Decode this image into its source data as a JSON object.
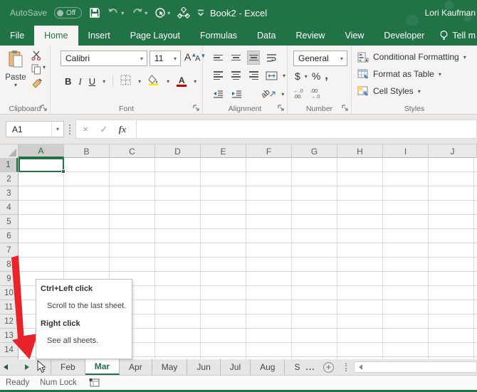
{
  "titlebar": {
    "autosave_label": "AutoSave",
    "autosave_state": "Off",
    "title": "Book2  -  Excel",
    "user": "Lori Kaufman"
  },
  "ribbon_tabs": {
    "items": [
      {
        "label": "File",
        "active": false
      },
      {
        "label": "Home",
        "active": true
      },
      {
        "label": "Insert",
        "active": false
      },
      {
        "label": "Page Layout",
        "active": false
      },
      {
        "label": "Formulas",
        "active": false
      },
      {
        "label": "Data",
        "active": false
      },
      {
        "label": "Review",
        "active": false
      },
      {
        "label": "View",
        "active": false
      },
      {
        "label": "Developer",
        "active": false
      }
    ],
    "tell_me": "Tell m"
  },
  "ribbon": {
    "clipboard": {
      "paste_label": "Paste",
      "group_label": "Clipboard"
    },
    "font": {
      "family": "Calibri",
      "size": "11",
      "bold": "B",
      "italic": "I",
      "underline": "U",
      "grow": "A",
      "shrink": "A",
      "color_letter": "A",
      "group_label": "Font"
    },
    "alignment": {
      "group_label": "Alignment",
      "orientation": "ab"
    },
    "number": {
      "format": "General",
      "currency": "$",
      "percent": "%",
      "comma": ",",
      "inc_top": "←.0",
      "inc_bot": ".00",
      "dec_top": ".00",
      "dec_bot": "→.0",
      "group_label": "Number"
    },
    "styles": {
      "conditional": "Conditional Formatting",
      "format_table": "Format as Table",
      "cell_styles": "Cell Styles",
      "group_label": "Styles"
    }
  },
  "formula_bar": {
    "name_box": "A1",
    "cancel": "×",
    "enter": "✓",
    "fx": "fx",
    "value": ""
  },
  "grid": {
    "columns": [
      "A",
      "B",
      "C",
      "D",
      "E",
      "F",
      "G",
      "H",
      "I",
      "J"
    ],
    "rows": [
      "1",
      "2",
      "3",
      "4",
      "5",
      "6",
      "7",
      "8",
      "9",
      "10",
      "11",
      "12",
      "13",
      "14"
    ],
    "selected_cell": "A1",
    "selected_column": "A",
    "selected_row": "1"
  },
  "sheet_tabs": {
    "left_ellipsis": "...",
    "tabs": [
      {
        "label": "Feb",
        "active": false
      },
      {
        "label": "Mar",
        "active": true
      },
      {
        "label": "Apr",
        "active": false
      },
      {
        "label": "May",
        "active": false
      },
      {
        "label": "Jun",
        "active": false
      },
      {
        "label": "Jul",
        "active": false
      },
      {
        "label": "Aug",
        "active": false
      },
      {
        "label": "S",
        "active": false,
        "partial": true
      }
    ],
    "right_ellipsis": "..."
  },
  "tooltip": {
    "title1": "Ctrl+Left click",
    "body1": "Scroll to the last sheet.",
    "title2": "Right click",
    "body2": "See all sheets."
  },
  "status_bar": {
    "mode": "Ready",
    "num_lock": "Num Lock"
  },
  "colors": {
    "excel_green": "#217346",
    "arrow_red": "#e8232a",
    "fill_yellow": "#ffe400",
    "font_red": "#c00000"
  }
}
